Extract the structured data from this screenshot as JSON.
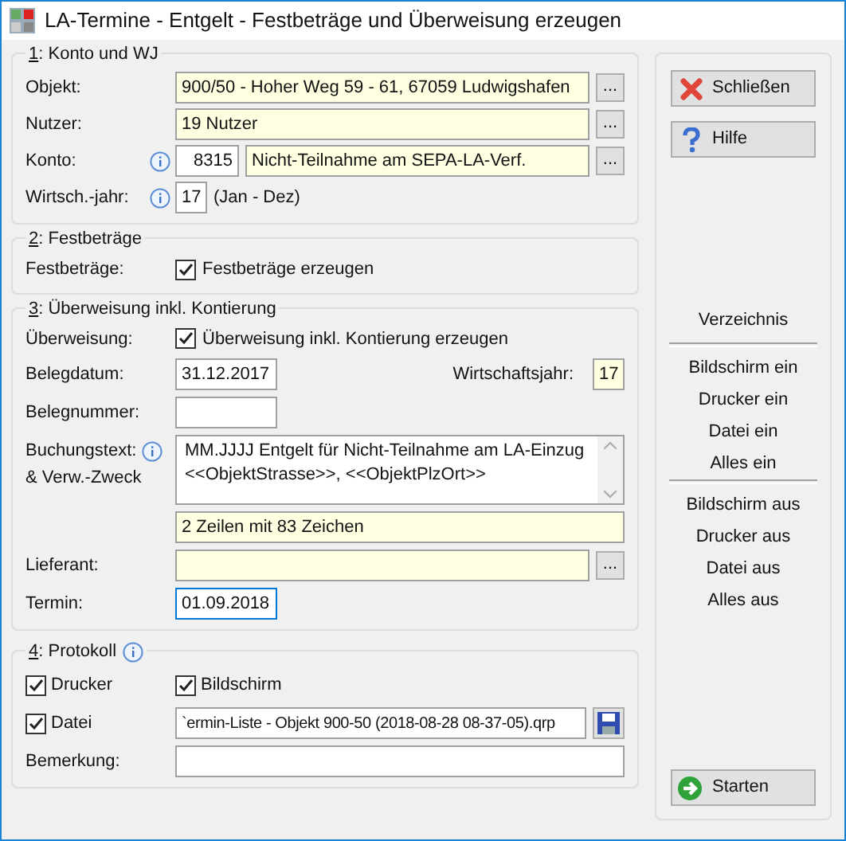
{
  "window": {
    "title": "LA-Termine - Entgelt - Festbeträge und Überweisung erzeugen"
  },
  "konto": {
    "number": "1",
    "title": ": Konto und WJ",
    "objekt": {
      "label": "Objekt:",
      "value": "900/50 - Hoher Weg 59 - 61, 67059 Ludwigshafen",
      "browse": "..."
    },
    "nutzer": {
      "label": "Nutzer:",
      "value": "19 Nutzer",
      "browse": "..."
    },
    "konto": {
      "label": "Konto:",
      "number": "8315",
      "value": "Nicht-Teilnahme am SEPA-LA-Verf.",
      "browse": "..."
    },
    "wj": {
      "label": "Wirtsch.-jahr:",
      "value": "17",
      "note": "(Jan - Dez)"
    }
  },
  "festbetraege": {
    "number": "2",
    "title": ": Festbeträge",
    "label": "Festbeträge:",
    "checkbox": {
      "label": "Festbeträge erzeugen",
      "checked": true
    }
  },
  "ueberweisung": {
    "number": "3",
    "title": ": Überweisung inkl. Kontierung",
    "label": "Überweisung:",
    "checkbox": {
      "label": "Überweisung inkl. Kontierung erzeugen",
      "checked": true
    },
    "belegdatum": {
      "label": "Belegdatum:",
      "value": "31.12.2017"
    },
    "wirtschaftsjahr": {
      "label": "Wirtschaftsjahr:",
      "value": "17"
    },
    "belegnummer": {
      "label": "Belegnummer:"
    },
    "buchungstext": {
      "label": "Buchungstext:",
      "label2": "& Verw.-Zweck",
      "lines": [
        "MM.JJJJ Entgelt für Nicht-Teilnahme am LA-Einzug",
        "<<ObjektStrasse>>, <<ObjektPlzOrt>>"
      ],
      "counter": "2 Zeilen mit 83 Zeichen"
    },
    "lieferant": {
      "label": "Lieferant:",
      "browse": "..."
    },
    "termin": {
      "label": "Termin:",
      "value": "01.09.2018",
      "focused": true
    }
  },
  "protokoll": {
    "number": "4",
    "title": ": Protokoll",
    "checks": [
      {
        "label": "Drucker",
        "checked": true
      },
      {
        "label": "Bildschirm",
        "checked": true
      },
      {
        "label": "Datei",
        "checked": true
      }
    ],
    "file": "`ermin-Liste - Objekt 900-50 (2018-08-28 08-37-05).qrp",
    "bemerkung": {
      "label": "Bemerkung:"
    }
  },
  "buttons": [
    {
      "label": "Schließen",
      "kind": "close"
    },
    {
      "label": "Hilfe",
      "kind": "help"
    }
  ],
  "directory": {
    "title": "Verzeichnis",
    "groups": [
      [
        "Bildschirm ein",
        "Drucker ein",
        "Datei ein",
        "Alles ein"
      ],
      [
        "Bildschirm aus",
        "Drucker aus",
        "Datei aus",
        "Alles aus"
      ]
    ]
  },
  "start": {
    "label": "Starten"
  }
}
